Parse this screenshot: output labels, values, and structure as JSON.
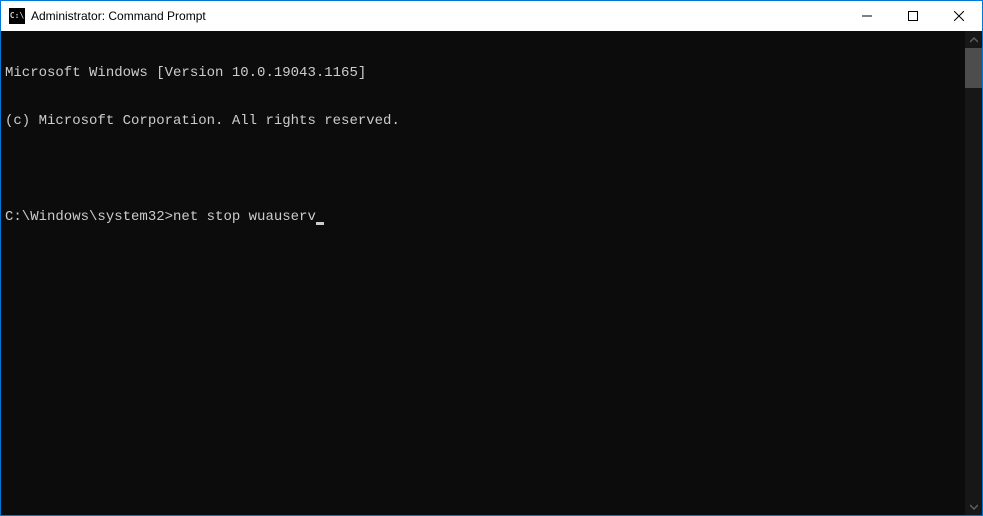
{
  "window": {
    "title": "Administrator: Command Prompt",
    "icon_label": "CMD"
  },
  "terminal": {
    "lines": [
      "Microsoft Windows [Version 10.0.19043.1165]",
      "(c) Microsoft Corporation. All rights reserved.",
      ""
    ],
    "prompt": "C:\\Windows\\system32>",
    "command": "net stop wuauserv"
  }
}
